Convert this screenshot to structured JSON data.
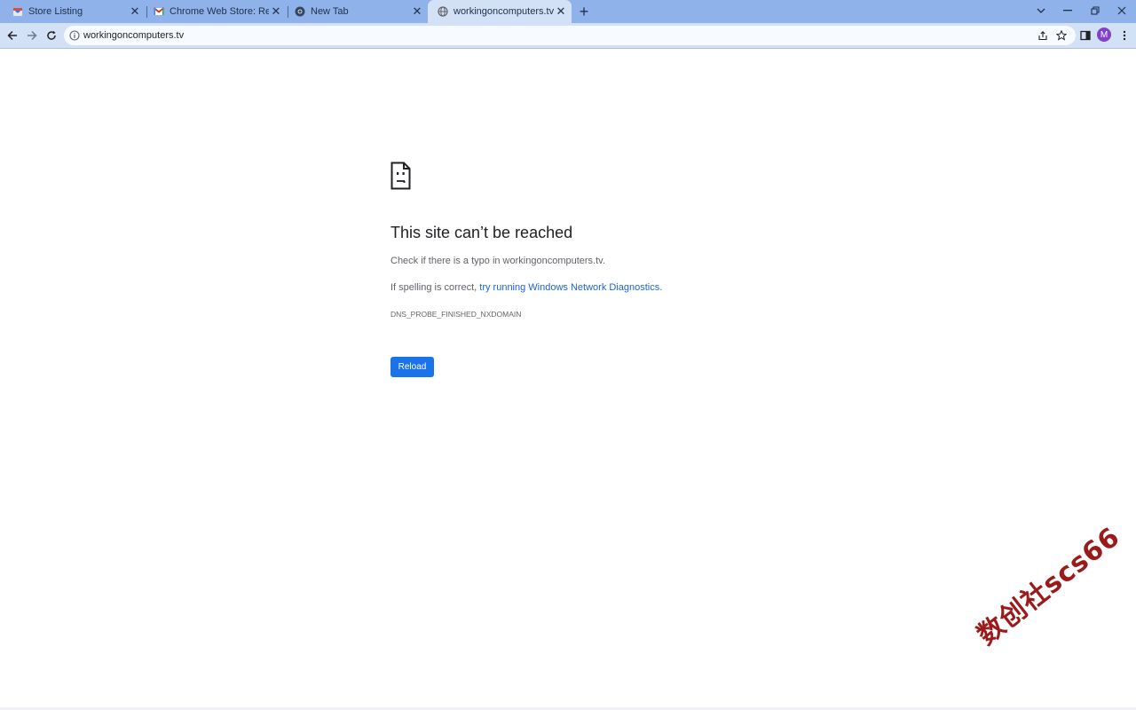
{
  "browser": {
    "tabs": [
      {
        "title": "Store Listing",
        "icon": "store-listing-favicon",
        "active": false
      },
      {
        "title": "Chrome Web Store: Rejection noti",
        "icon": "gmail-icon",
        "active": false
      },
      {
        "title": "New Tab",
        "icon": "chrome-icon",
        "active": false
      },
      {
        "title": "workingoncomputers.tv",
        "icon": "globe-icon",
        "active": true
      }
    ],
    "new_tab_label": "+",
    "window_controls": {
      "dropdown": "⌄",
      "minimize": "–",
      "restore": "❐",
      "close": "✕"
    },
    "address_bar": {
      "url": "workingoncomputers.tv"
    },
    "profile_initial": "M",
    "colors": {
      "tabstrip": "#8fb2ea",
      "toolbar": "#d3e1f6",
      "accent": "#1a73e8",
      "avatar": "#8142c8"
    }
  },
  "error_page": {
    "heading": "This site can’t be reached",
    "line1": "Check if there is a typo in workingoncomputers.tv.",
    "line2_prefix": "If spelling is correct, ",
    "line2_link": "try running Windows Network Diagnostics",
    "line2_suffix": ".",
    "error_code": "DNS_PROBE_FINISHED_NXDOMAIN",
    "reload_label": "Reload"
  },
  "watermark": "数创社scs66"
}
